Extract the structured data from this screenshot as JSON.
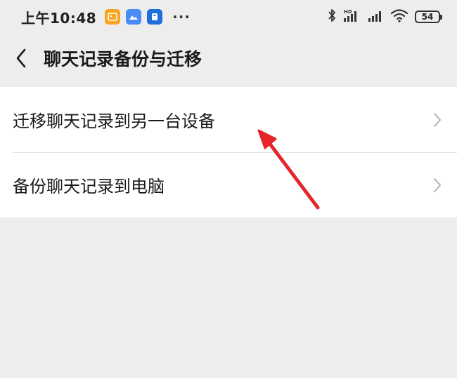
{
  "status_bar": {
    "time": "上午10:48",
    "more": "···",
    "network_label": "HD",
    "battery_level": "54",
    "icons": [
      "bluetooth-icon",
      "signal-icon",
      "signal-icon",
      "wifi-icon",
      "battery-icon"
    ]
  },
  "header": {
    "title": "聊天记录备份与迁移",
    "back_icon": "chevron-left-icon"
  },
  "list": {
    "items": [
      {
        "label": "迁移聊天记录到另一台设备",
        "icon": "chevron-right-icon"
      },
      {
        "label": "备份聊天记录到电脑",
        "icon": "chevron-right-icon"
      }
    ]
  },
  "colors": {
    "background": "#ededed",
    "list_background": "#ffffff",
    "annotation_arrow": "#e4262b",
    "badge_orange": "#f6a623",
    "badge_blue": "#4a8cf7",
    "badge_dark": "#1e6fd9"
  }
}
